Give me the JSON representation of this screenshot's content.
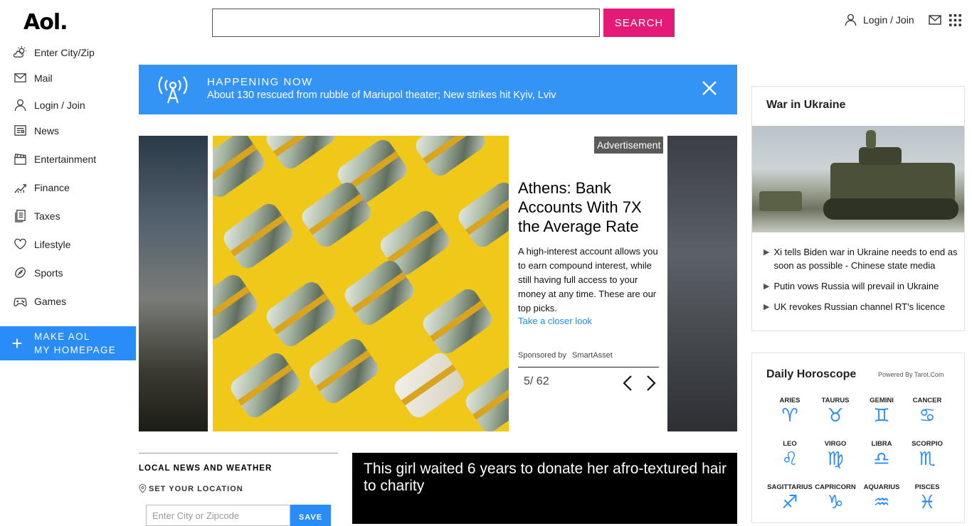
{
  "header": {
    "logo": "Aol.",
    "search_value": "",
    "search_button": "SEARCH",
    "login_label": "Login / Join"
  },
  "sidebar": {
    "items": [
      {
        "label": "Enter City/Zip",
        "icon": "weather-icon"
      },
      {
        "label": "Mail",
        "icon": "mail-icon"
      },
      {
        "label": "Login / Join",
        "icon": "user-icon"
      },
      {
        "label": "News",
        "icon": "news-icon"
      },
      {
        "label": "Entertainment",
        "icon": "clapperboard-icon"
      },
      {
        "label": "Finance",
        "icon": "chart-icon"
      },
      {
        "label": "Taxes",
        "icon": "document-icon"
      },
      {
        "label": "Lifestyle",
        "icon": "heart-icon"
      },
      {
        "label": "Sports",
        "icon": "ball-icon"
      },
      {
        "label": "Games",
        "icon": "gamepad-icon"
      }
    ],
    "make_homepage_line1": "MAKE AOL",
    "make_homepage_line2": "MY HOMEPAGE"
  },
  "happening": {
    "title": "HAPPENING NOW",
    "text": "About 130 rescued from rubble of Mariupol theater; New strikes hit Kyiv, Lviv"
  },
  "carousel": {
    "ad_badge": "Advertisement",
    "title": "Athens: Bank Accounts With 7X the Average Rate",
    "body": "A high-interest account allows you to earn compound interest, while still having full access to your money at any time. These are our top picks.",
    "link": "Take a closer look",
    "sponsored_by": "Sponsored by",
    "sponsor": "SmartAsset",
    "counter": "5/ 62"
  },
  "local": {
    "title": "LOCAL NEWS AND WEATHER",
    "set_location": "SET YOUR LOCATION",
    "zip_placeholder": "Enter City or Zipcode",
    "save": "SAVE"
  },
  "video": {
    "title": "This girl waited 6 years to donate her afro-textured hair to charity"
  },
  "ukraine": {
    "title": "War in Ukraine",
    "items": [
      "Xi tells Biden war in Ukraine needs to end as soon as possible - Chinese state media",
      "Putin vows Russia will prevail in Ukraine",
      "UK revokes Russian channel RT's licence"
    ]
  },
  "horoscope": {
    "title": "Daily Horoscope",
    "powered": "Powered By Tarot.Com",
    "signs": [
      {
        "name": "ARIES",
        "glyph": "♈"
      },
      {
        "name": "TAURUS",
        "glyph": "♉"
      },
      {
        "name": "GEMINI",
        "glyph": "♊"
      },
      {
        "name": "CANCER",
        "glyph": "♋"
      },
      {
        "name": "LEO",
        "glyph": "♌"
      },
      {
        "name": "VIRGO",
        "glyph": "♍"
      },
      {
        "name": "LIBRA",
        "glyph": "♎"
      },
      {
        "name": "SCORPIO",
        "glyph": "♏"
      },
      {
        "name": "SAGITTARIUS",
        "glyph": "♐"
      },
      {
        "name": "CAPRICORN",
        "glyph": "♑"
      },
      {
        "name": "AQUARIUS",
        "glyph": "♒"
      },
      {
        "name": "PISCES",
        "glyph": "♓"
      }
    ]
  },
  "colors": {
    "accent_pink": "#e51a77",
    "accent_blue": "#2a8cf7",
    "happening_blue": "#3494f5"
  }
}
